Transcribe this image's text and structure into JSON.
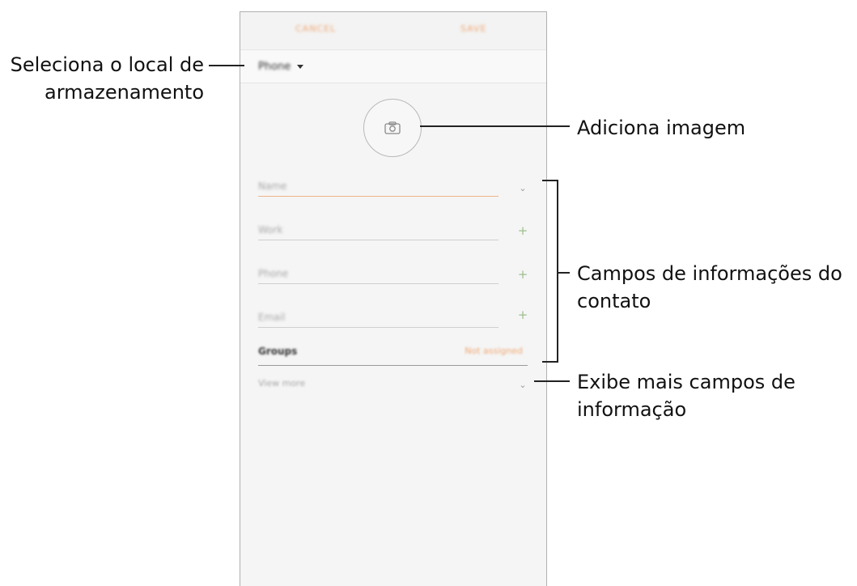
{
  "topbar": {
    "cancel_label": "CANCEL",
    "save_label": "SAVE"
  },
  "storage": {
    "label": "Phone"
  },
  "photo": {
    "icon": "camera-icon"
  },
  "fields": [
    {
      "placeholder": "Name",
      "icon": "chevron-down-icon"
    },
    {
      "placeholder": "Work",
      "icon": "plus-icon"
    },
    {
      "placeholder": "Phone",
      "icon": "plus-icon"
    },
    {
      "placeholder": "Email",
      "icon": "plus-icon"
    }
  ],
  "groups": {
    "label": "Groups",
    "value": "Not assigned"
  },
  "more": {
    "label": "View more",
    "icon": "chevron-down-icon"
  },
  "callouts": {
    "storage_line1": "Seleciona o local de",
    "storage_line2": "armazenamento",
    "image": "Adiciona imagem",
    "fields_line1": "Campos de informações do",
    "fields_line2": "contato",
    "more_line1": "Exibe mais campos de",
    "more_line2": "informação"
  },
  "colors": {
    "accent": "#f0a874",
    "plus": "#9cbf8f",
    "screen_bg": "#f5f5f5"
  }
}
